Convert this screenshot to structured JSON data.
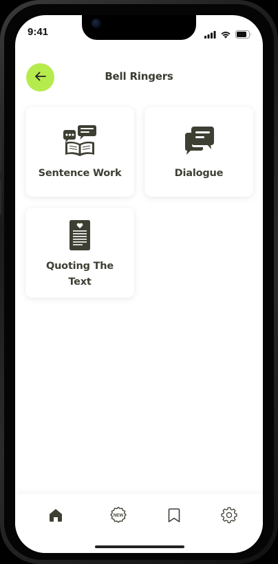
{
  "status_bar": {
    "time": "9:41"
  },
  "header": {
    "title": "Bell Ringers",
    "back_icon": "arrow-left-icon",
    "accent_color": "#b6eb4d"
  },
  "cards": [
    {
      "label": "Sentence Work",
      "icon": "book-chat-icon"
    },
    {
      "label": "Dialogue",
      "icon": "chat-bubbles-icon"
    },
    {
      "label": "Quoting The Text",
      "icon": "document-heart-icon"
    }
  ],
  "bottom_nav": {
    "items": [
      {
        "name": "home",
        "icon": "home-icon",
        "active": true
      },
      {
        "name": "new",
        "icon": "new-badge-icon",
        "badge_text": "NEW"
      },
      {
        "name": "bookmarks",
        "icon": "bookmark-icon"
      },
      {
        "name": "settings",
        "icon": "gear-icon"
      }
    ]
  },
  "colors": {
    "icon_dark": "#3d3f33",
    "text_dark": "#3b3d32"
  }
}
